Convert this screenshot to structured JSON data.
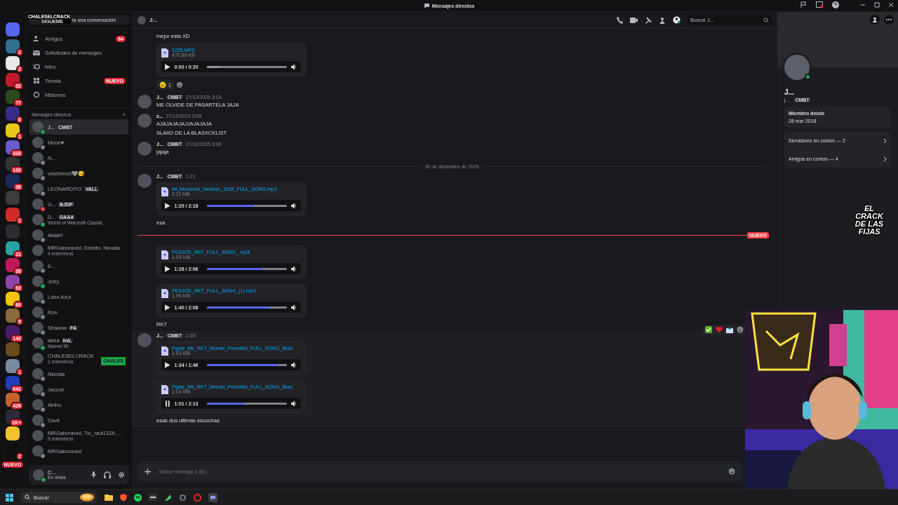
{
  "titlebar": {
    "title": "Mensajes directos"
  },
  "servers": [
    {
      "color": "#5865f2"
    },
    {
      "color": "#2f6f8f",
      "badge": "2"
    },
    {
      "color": "#e8e8e8",
      "badge": "2"
    },
    {
      "color": "#c0182a",
      "badge": "32"
    },
    {
      "color": "#2d4a1e",
      "badge": "77"
    },
    {
      "color": "#3a2a8a",
      "badge": "6"
    },
    {
      "color": "#e6c619",
      "badge": "1"
    },
    {
      "color": "#6a5acd",
      "badge": "333"
    },
    {
      "color": "#333333",
      "badge": "100"
    },
    {
      "color": "#1a2a5a",
      "badge": "36"
    },
    {
      "color": "#3c3c3c"
    },
    {
      "color": "#d42a2a",
      "badge": "1"
    },
    {
      "color": "#2b2d31"
    },
    {
      "color": "#2aa0a0",
      "badge": "21"
    },
    {
      "color": "#c2185b",
      "badge": "38"
    },
    {
      "color": "#8e44ad",
      "badge": "92"
    },
    {
      "color": "#f1c40f",
      "badge": "60"
    },
    {
      "color": "#8a6a3a",
      "badge": "5"
    },
    {
      "color": "#4a1a6a",
      "badge": "142"
    },
    {
      "color": "#6a4a1a"
    },
    {
      "color": "#7a8aa0",
      "badge": "1"
    },
    {
      "color": "#1f3fbf",
      "badge": "641"
    },
    {
      "color": "#c4622d",
      "badge": "426"
    },
    {
      "color": "#2a2a3a",
      "badge": "1K+"
    },
    {
      "color": "#f2c12e"
    },
    {
      "color": "#101010",
      "badge": "2"
    }
  ],
  "servers_new": "NUEVO",
  "search": {
    "placeholder": "la una conversación",
    "overlay_name": "CHALESELCRACK",
    "overlay_sub": "SIGUEME"
  },
  "nav": [
    {
      "kind": "friends",
      "label": "Amigos",
      "badge": "64"
    },
    {
      "kind": "requests",
      "label": "Solicitudes de mensajes"
    },
    {
      "kind": "nitro",
      "label": "Nitro"
    },
    {
      "kind": "shop",
      "label": "Tienda",
      "badge": "NUEVO"
    },
    {
      "kind": "quests",
      "label": "Misiones"
    }
  ],
  "dm_header": {
    "label": "Mensajes directos",
    "add": "+"
  },
  "dms": [
    {
      "name": "J...",
      "tag": "CMBT",
      "color": "#23a55a",
      "selected": true
    },
    {
      "name": "Moon♥",
      "color": "#80848e",
      "selected": false
    },
    {
      "name": "N...",
      "color": "#80848e",
      "selected": false
    },
    {
      "name": "velchimort🩶😘",
      "color": "#80848e",
      "selected": false
    },
    {
      "name": "LEONARDITO",
      "tag": "VALL",
      "color": "#80848e",
      "selected": false
    },
    {
      "name": "G...",
      "tag": "BJDP",
      "color": "#f23f43",
      "selected": false
    },
    {
      "name": "D...",
      "tag": "GAAA",
      "activity": "World of Warcraft Classic",
      "color": "#23a55a",
      "selected": false
    },
    {
      "name": "Aldairt",
      "color": "#80848e",
      "selected": false
    },
    {
      "name": "MRGaboraxlol, Dinsito, Nicolás",
      "sub": "4 miembros",
      "selected": false
    },
    {
      "name": "6...",
      "color": "#80848e",
      "selected": false
    },
    {
      "name": "Jefry",
      "color": "#23a55a",
      "selected": false
    },
    {
      "name": "Lobo Azul",
      "color": "#80848e",
      "selected": false
    },
    {
      "name": "Ron",
      "color": "#80848e",
      "selected": false
    },
    {
      "name": "Shadow",
      "tag": "FA",
      "color": "#80848e",
      "selected": false
    },
    {
      "name": "atma",
      "tag": "hvL",
      "activity": "Marvel Ri",
      "color": "#23a55a",
      "selected": false
    },
    {
      "name": "CHALESELCRACK",
      "sub": "1 miembros",
      "overlay": "CHALES",
      "selected": false
    },
    {
      "name": "Nicolás",
      "color": "#80848e",
      "selected": false
    },
    {
      "name": "Jaccob",
      "color": "#80848e",
      "selected": false
    },
    {
      "name": "Alriho",
      "color": "#80848e",
      "selected": false
    },
    {
      "name": "Devil",
      "color": "#80848e",
      "selected": false
    },
    {
      "name": "MRGaboraxlol, Tio_raul1319, ...",
      "sub": "5 miembros",
      "selected": false
    },
    {
      "name": "MRGaboraxlol",
      "color": "#80848e",
      "selected": false
    }
  ],
  "user": {
    "name": "C...",
    "status_text": "En línea"
  },
  "chat": {
    "name": "J...",
    "search_placeholder": "Buscar J...",
    "composer_placeholder": "Enviar mensaje a @J..."
  },
  "feed": [
    {
      "kind": "group",
      "hovered": false,
      "items": [
        {
          "kind": "text",
          "text": "mejor esta XD"
        },
        {
          "kind": "audio",
          "file": "1225.MP3",
          "size": "470.86 KB",
          "time": "0:00 / 0:20",
          "level": 0.16,
          "started": false,
          "playing": false
        },
        {
          "kind": "reactions",
          "count": "1"
        }
      ]
    },
    {
      "kind": "group",
      "author": "J...",
      "tag": "CMBT",
      "time": "27/12/2025 3:03",
      "hovered": false,
      "items": [
        {
          "kind": "text",
          "text": "ME OLVIDE DE PASARTELA JAJA"
        }
      ]
    },
    {
      "kind": "group",
      "author": "c...",
      "time": "27/12/2025 3:05",
      "hovered": false,
      "items": [
        {
          "kind": "text",
          "text": "AJAJAJAJAJJAJAJAJA"
        },
        {
          "kind": "text",
          "text": "SLAIIO DE LA BLASXCKLIST"
        }
      ]
    },
    {
      "kind": "group",
      "author": "J...",
      "tag": "CMBT",
      "time": "27/12/2025 3:06",
      "hovered": false,
      "items": [
        {
          "kind": "text",
          "text": "jajaja"
        }
      ]
    },
    {
      "kind": "date",
      "text": "30 de diciembre de 2025"
    },
    {
      "kind": "group",
      "author": "J...",
      "tag": "CMBT",
      "time": "1:21",
      "hovered": false,
      "items": [
        {
          "kind": "audio",
          "file": "Mi_Momento_Session_2026_FULL_SONG.mp3",
          "size": "2.11 MB",
          "time": "1:20 / 2:18",
          "level": 0.59,
          "started": true,
          "playing": false
        },
        {
          "kind": "text",
          "text": "esa"
        }
      ]
    },
    {
      "kind": "new",
      "label": "NUEVO"
    },
    {
      "kind": "group",
      "hovered": false,
      "items": [
        {
          "kind": "audio",
          "file": "PEGATE_RKT_FULL_SONG_.mp3",
          "size": "1.93 MB",
          "time": "1:26 / 2:06",
          "level": 0.69,
          "started": true,
          "playing": false
        },
        {
          "kind": "audio",
          "file": "PEGATE_RKT_FULL_SONG_(1).mp3",
          "size": "1.96 MB",
          "time": "1:40 / 2:08",
          "level": 0.79,
          "started": true,
          "playing": false
        },
        {
          "kind": "text",
          "text": "RKT"
        }
      ]
    },
    {
      "kind": "group",
      "author": "J...",
      "tag": "CMBT",
      "time": "1:36",
      "hovered": true,
      "items": [
        {
          "kind": "audio",
          "file": "Pgate_Ms_RKT_Stream_Prendido_FULL_SONG_Musi",
          "size": "1.63 MB",
          "time": "1:34 / 1:46",
          "level": 0.89,
          "started": true,
          "playing": false
        },
        {
          "kind": "audio",
          "file": "Pgate_Ms_RKT_Stream_Prendido_FULL_SONG_Musi",
          "size": "2.04 MB",
          "time": "1:01 / 2:13",
          "level": 0.47,
          "started": true,
          "playing": true
        },
        {
          "kind": "text",
          "text": "esas dos ultimas escuchas"
        }
      ]
    }
  ],
  "profile": {
    "name": "J...",
    "username": "j...",
    "tag": "CMBT",
    "member_label": "Miembro desde",
    "member_since": "28 mar 2018",
    "links": [
      "Servidores en común — 2",
      "Amigos en común — 4"
    ]
  },
  "stream": {
    "logo_lines": [
      "EL",
      "CRACK",
      "DE LAS",
      "FIJAS"
    ]
  },
  "taskbar": {
    "search": "Buscar"
  }
}
